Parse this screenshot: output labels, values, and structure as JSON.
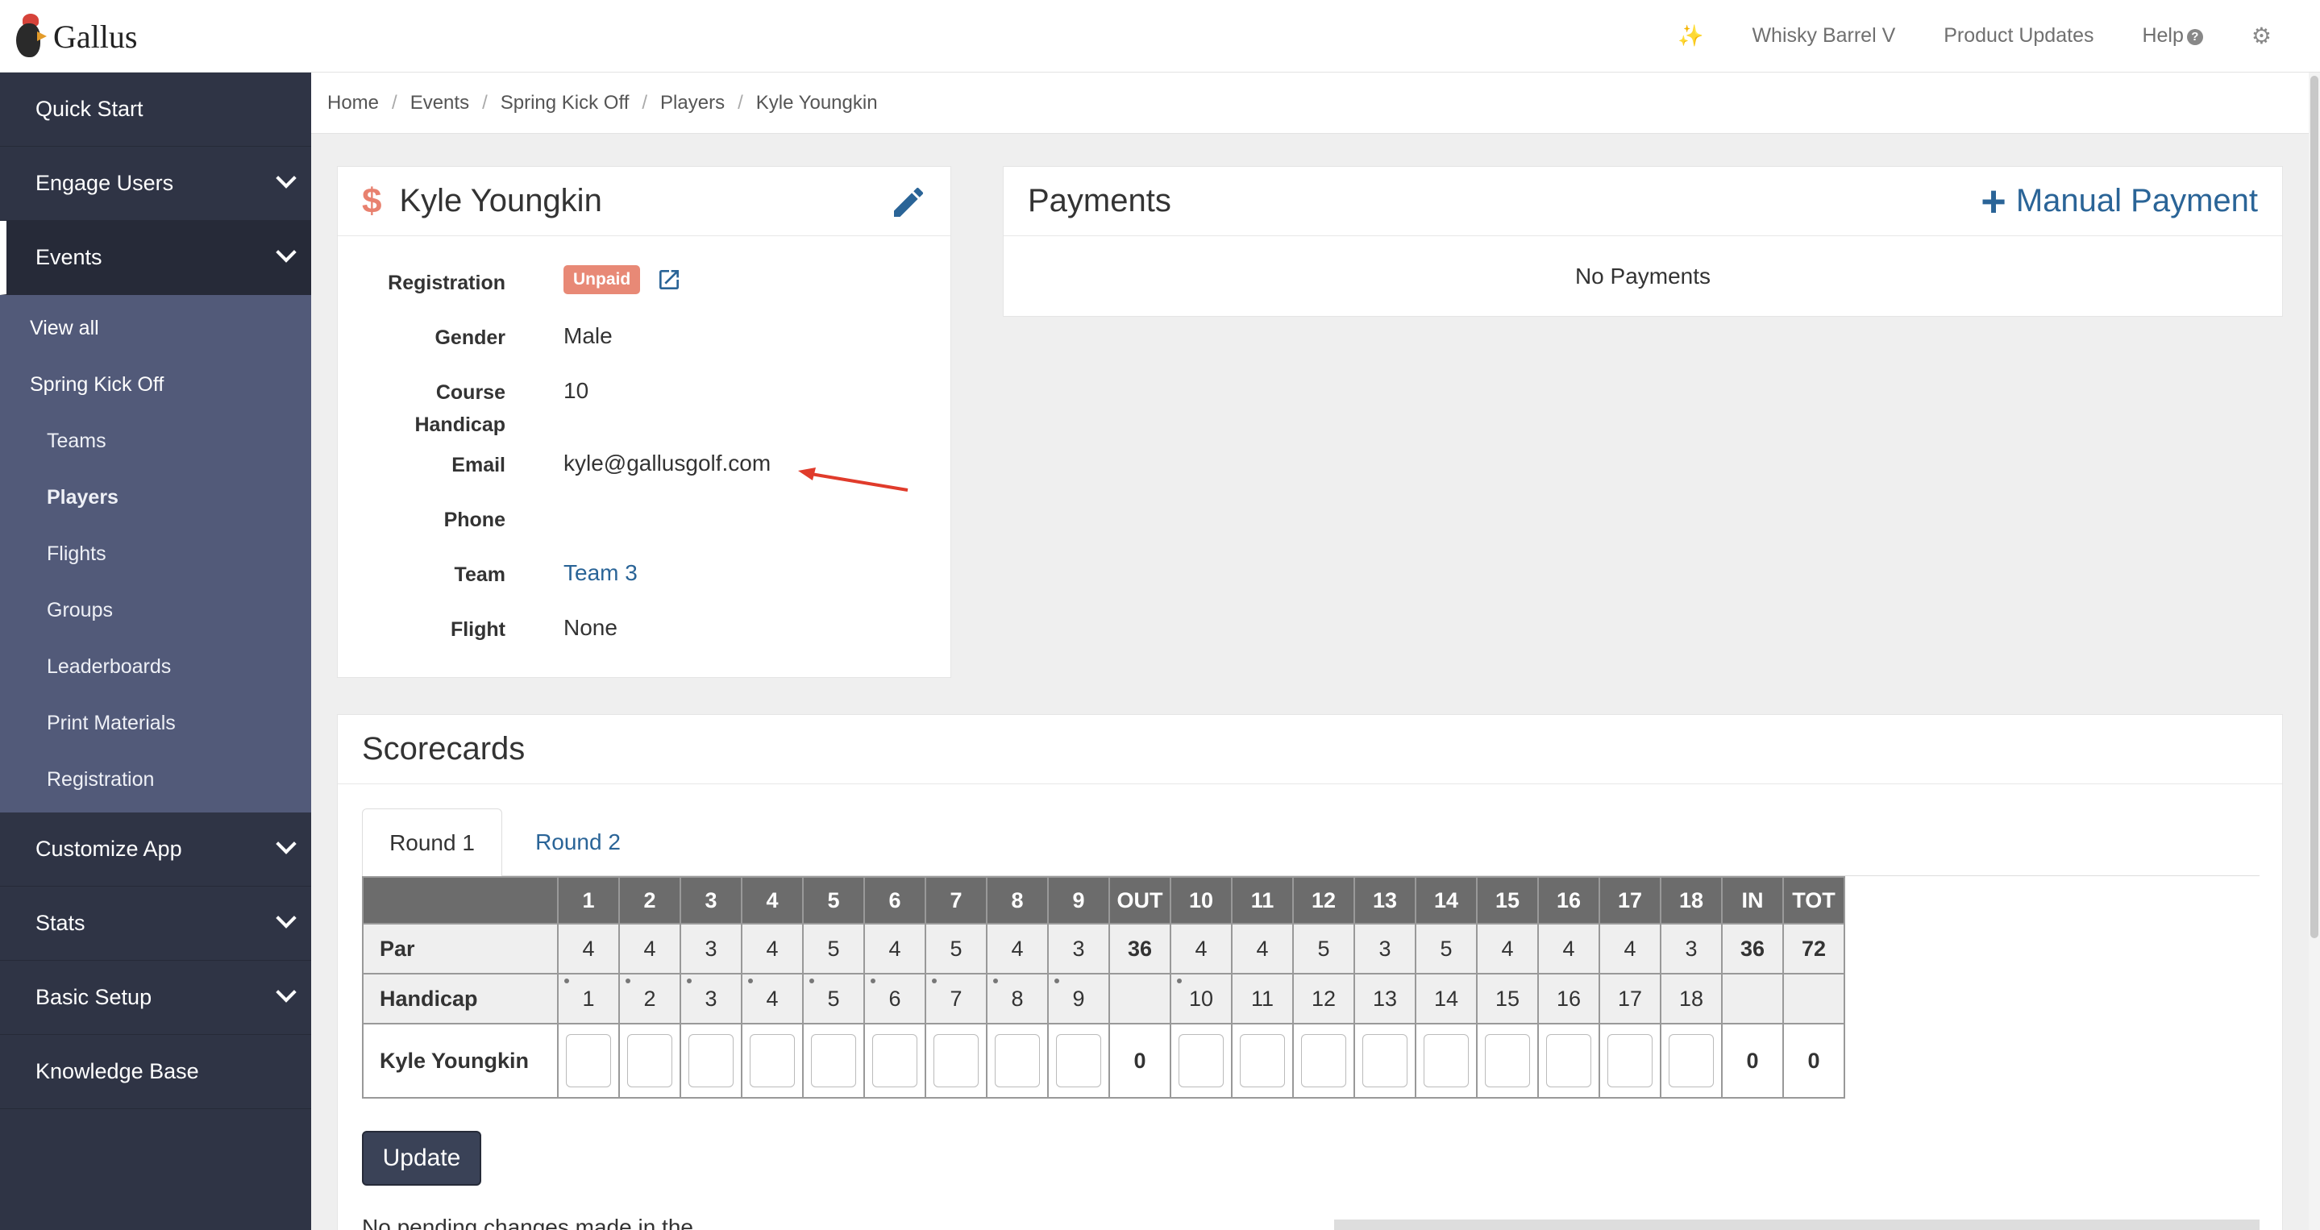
{
  "app": {
    "name": "Gallus"
  },
  "topnav": {
    "wand_icon": "magic-wand-icon",
    "event_name": "Whisky Barrel V",
    "product_updates": "Product Updates",
    "help": "Help",
    "help_glyph": "?",
    "gear_icon": "gear-icon"
  },
  "sidebar": {
    "quick_start": "Quick Start",
    "engage_users": "Engage Users",
    "events": "Events",
    "events_sub": {
      "view_all": "View all",
      "spring_kick_off": "Spring Kick Off",
      "teams": "Teams",
      "players": "Players",
      "flights": "Flights",
      "groups": "Groups",
      "leaderboards": "Leaderboards",
      "print_materials": "Print Materials",
      "registration": "Registration"
    },
    "customize_app": "Customize App",
    "stats": "Stats",
    "basic_setup": "Basic Setup",
    "knowledge_base": "Knowledge Base"
  },
  "breadcrumb": [
    "Home",
    "Events",
    "Spring Kick Off",
    "Players",
    "Kyle Youngkin"
  ],
  "player": {
    "dollar": "$",
    "name": "Kyle Youngkin",
    "labels": {
      "registration": "Registration",
      "gender": "Gender",
      "course_handicap_1": "Course",
      "course_handicap_2": "Handicap",
      "email": "Email",
      "phone": "Phone",
      "team": "Team",
      "flight": "Flight"
    },
    "registration_status": "Unpaid",
    "gender": "Male",
    "course_handicap": "10",
    "email": "kyle@gallusgolf.com",
    "phone": "",
    "team": "Team 3",
    "flight": "None"
  },
  "payments": {
    "title": "Payments",
    "plus": "+",
    "manual_payment": "Manual Payment",
    "empty": "No Payments"
  },
  "scorecards": {
    "title": "Scorecards",
    "tabs": [
      "Round 1",
      "Round 2"
    ],
    "header": [
      "",
      "1",
      "2",
      "3",
      "4",
      "5",
      "6",
      "7",
      "8",
      "9",
      "OUT",
      "10",
      "11",
      "12",
      "13",
      "14",
      "15",
      "16",
      "17",
      "18",
      "IN",
      "TOT"
    ],
    "par": [
      "Par",
      "4",
      "4",
      "3",
      "4",
      "5",
      "4",
      "5",
      "4",
      "3",
      "36",
      "4",
      "4",
      "5",
      "3",
      "5",
      "4",
      "4",
      "4",
      "3",
      "36",
      "72"
    ],
    "handicap": [
      "Handicap",
      "1",
      "2",
      "3",
      "4",
      "5",
      "6",
      "7",
      "8",
      "9",
      "",
      "10",
      "11",
      "12",
      "13",
      "14",
      "15",
      "16",
      "17",
      "18",
      "",
      ""
    ],
    "player_row": {
      "name": "Kyle Youngkin",
      "out": "0",
      "in": "0",
      "tot": "0"
    },
    "update": "Update",
    "footer_partial": "No pending changes made in the"
  },
  "colors": {
    "sidebar_bg": "#2f3445",
    "subnav_bg": "#525a79",
    "link": "#2a6497",
    "unpaid_badge": "#e88976",
    "annotation_arrow": "#e03b2b"
  }
}
